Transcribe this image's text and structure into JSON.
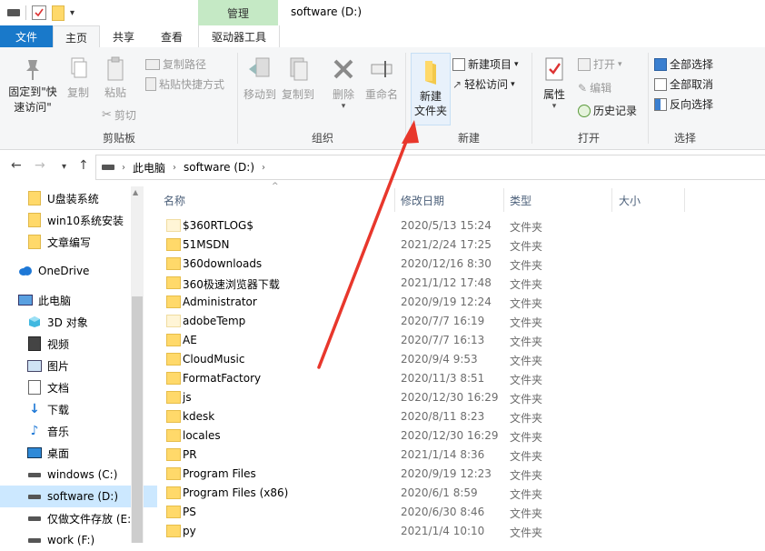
{
  "titlebar": {
    "manage_label": "管理",
    "window_title": "software (D:)"
  },
  "tabs": {
    "file": "文件",
    "home": "主页",
    "share": "共享",
    "view": "查看",
    "drive_tools": "驱动器工具"
  },
  "ribbon": {
    "clipboard": {
      "pin": "固定到\"快\n速访问\"",
      "copy": "复制",
      "paste": "粘贴",
      "copy_path": "复制路径",
      "paste_shortcut": "粘贴快捷方式",
      "cut": "剪切",
      "label": "剪贴板"
    },
    "organize": {
      "move_to": "移动到",
      "copy_to": "复制到",
      "delete": "删除",
      "rename": "重命名",
      "label": "组织"
    },
    "new": {
      "new_folder_line1": "新建",
      "new_folder_line2": "文件夹",
      "new_item": "新建项目",
      "easy_access": "轻松访问",
      "label": "新建"
    },
    "open": {
      "properties": "属性",
      "open": "打开",
      "edit": "编辑",
      "history": "历史记录",
      "label": "打开"
    },
    "select": {
      "select_all": "全部选择",
      "select_none": "全部取消",
      "invert": "反向选择",
      "label": "选择"
    }
  },
  "address": {
    "crumbs": [
      "此电脑",
      "software (D:)"
    ]
  },
  "nav": {
    "items": [
      {
        "label": "U盘装系统",
        "icon": "folder-icon"
      },
      {
        "label": "win10系统安装",
        "icon": "folder-icon"
      },
      {
        "label": "文章编写",
        "icon": "folder-icon"
      },
      {
        "label": "OneDrive",
        "icon": "cloud-icon"
      },
      {
        "label": "此电脑",
        "icon": "computer-icon"
      },
      {
        "label": "3D 对象",
        "icon": "cube-icon"
      },
      {
        "label": "视频",
        "icon": "video-icon"
      },
      {
        "label": "图片",
        "icon": "picture-icon"
      },
      {
        "label": "文档",
        "icon": "document-icon"
      },
      {
        "label": "下载",
        "icon": "download-icon"
      },
      {
        "label": "音乐",
        "icon": "music-icon"
      },
      {
        "label": "桌面",
        "icon": "desktop-icon"
      },
      {
        "label": "windows (C:)",
        "icon": "drive-icon"
      },
      {
        "label": "software (D:)",
        "icon": "drive-icon"
      },
      {
        "label": "仅做文件存放 (E:",
        "icon": "drive-icon"
      },
      {
        "label": "work (F:)",
        "icon": "drive-icon"
      }
    ]
  },
  "columns": {
    "name": "名称",
    "date": "修改日期",
    "type": "类型",
    "size": "大小"
  },
  "files": [
    {
      "name": "$360RTLOG$",
      "date": "2020/5/13 15:24",
      "type": "文件夹"
    },
    {
      "name": "51MSDN",
      "date": "2021/2/24 17:25",
      "type": "文件夹"
    },
    {
      "name": "360downloads",
      "date": "2020/12/16 8:30",
      "type": "文件夹"
    },
    {
      "name": "360极速浏览器下载",
      "date": "2021/1/12 17:48",
      "type": "文件夹"
    },
    {
      "name": "Administrator",
      "date": "2020/9/19 12:24",
      "type": "文件夹"
    },
    {
      "name": "adobeTemp",
      "date": "2020/7/7 16:19",
      "type": "文件夹"
    },
    {
      "name": "AE",
      "date": "2020/7/7 16:13",
      "type": "文件夹"
    },
    {
      "name": "CloudMusic",
      "date": "2020/9/4 9:53",
      "type": "文件夹"
    },
    {
      "name": "FormatFactory",
      "date": "2020/11/3 8:51",
      "type": "文件夹"
    },
    {
      "name": "js",
      "date": "2020/12/30 16:29",
      "type": "文件夹"
    },
    {
      "name": "kdesk",
      "date": "2020/8/11 8:23",
      "type": "文件夹"
    },
    {
      "name": "locales",
      "date": "2020/12/30 16:29",
      "type": "文件夹"
    },
    {
      "name": "PR",
      "date": "2021/1/14 8:36",
      "type": "文件夹"
    },
    {
      "name": "Program Files",
      "date": "2020/9/19 12:23",
      "type": "文件夹"
    },
    {
      "name": "Program Files (x86)",
      "date": "2020/6/1 8:59",
      "type": "文件夹"
    },
    {
      "name": "PS",
      "date": "2020/6/30 8:46",
      "type": "文件夹"
    },
    {
      "name": "py",
      "date": "2021/1/4 10:10",
      "type": "文件夹"
    }
  ],
  "colors": {
    "accent": "#1979ca",
    "manage_tab": "#c5e9c5",
    "folder": "#ffd96a",
    "selection": "#cce8ff",
    "annotation_arrow": "#e8372c"
  }
}
